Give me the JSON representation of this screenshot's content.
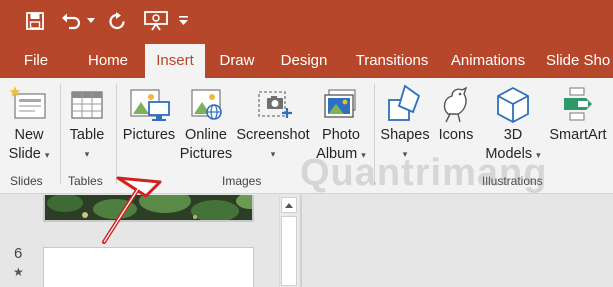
{
  "colors": {
    "brand": "#b7472a",
    "ribbon_bg": "#f3f3f3",
    "arrow": "#d21f1f"
  },
  "quick_access": [
    {
      "name": "save-icon"
    },
    {
      "name": "undo-icon"
    },
    {
      "name": "redo-icon"
    },
    {
      "name": "present-from-beginning-icon"
    }
  ],
  "tabs": [
    "File",
    "Home",
    "Insert",
    "Draw",
    "Design",
    "Transitions",
    "Animations",
    "Slide Sho"
  ],
  "active_tab": "Insert",
  "ribbon": {
    "new_slide": {
      "line1": "New",
      "line2": "Slide"
    },
    "table": {
      "line1": "Table"
    },
    "pictures": {
      "line1": "Pictures"
    },
    "online_pictures": {
      "line1": "Online",
      "line2": "Pictures"
    },
    "screenshot": {
      "line1": "Screenshot"
    },
    "photo_album": {
      "line1": "Photo",
      "line2": "Album"
    },
    "shapes": {
      "line1": "Shapes"
    },
    "icons": {
      "line1": "Icons"
    },
    "models_3d": {
      "line1": "3D",
      "line2": "Models"
    },
    "smartart": {
      "line1": "SmartArt"
    },
    "caret": "▾",
    "groups": {
      "slides": "Slides",
      "tables": "Tables",
      "images": "Images",
      "illustrations": "Illustrations"
    }
  },
  "slide_pane": {
    "slide_number": "6",
    "transition_mark": "★"
  },
  "watermark": "Quantrimang"
}
